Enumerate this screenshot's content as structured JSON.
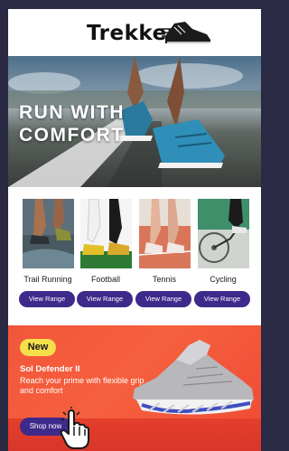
{
  "brand": {
    "name": "Trekker"
  },
  "hero": {
    "title_line1": "RUN WITH",
    "title_line2": "COMFORT"
  },
  "categories": [
    {
      "label": "Trail Running",
      "button": "View Range"
    },
    {
      "label": "Football",
      "button": "View Range"
    },
    {
      "label": "Tennis",
      "button": "View Range"
    },
    {
      "label": "Cycling",
      "button": "View Range"
    }
  ],
  "promo": {
    "badge": "New",
    "title": "Sol Defender II",
    "description": "Reach your prime with flexible grip and comfort",
    "button": "Shop now"
  },
  "colors": {
    "button_bg": "#3d2a8a",
    "promo_bg": "#f2563a",
    "badge_bg": "#f5e04a",
    "frame_bg": "#2b2a44"
  },
  "icons": [
    "running-shoe-logo-icon",
    "hand-pointer-cursor-icon"
  ]
}
